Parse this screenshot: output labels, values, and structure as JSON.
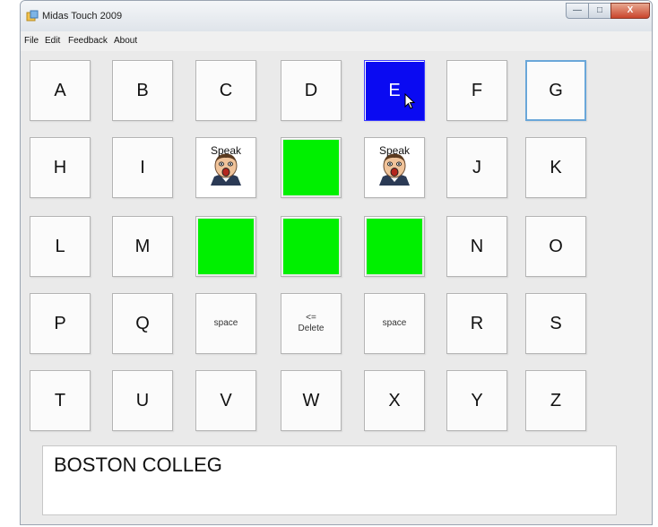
{
  "window": {
    "title": "Midas Touch 2009"
  },
  "titlebar_buttons": {
    "minimize": "—",
    "maximize": "□",
    "close": "X"
  },
  "menu": [
    "File",
    "Edit",
    "Feedback",
    "About"
  ],
  "grid": {
    "rows": [
      [
        {
          "type": "letter",
          "label": "A"
        },
        {
          "type": "letter",
          "label": "B"
        },
        {
          "type": "letter",
          "label": "C"
        },
        {
          "type": "letter",
          "label": "D"
        },
        {
          "type": "letter",
          "label": "E",
          "state": "selected"
        },
        {
          "type": "letter",
          "label": "F"
        },
        {
          "type": "letter",
          "label": "G",
          "state": "focused"
        }
      ],
      [
        {
          "type": "letter",
          "label": "H"
        },
        {
          "type": "letter",
          "label": "I"
        },
        {
          "type": "speak",
          "label": "Speak"
        },
        {
          "type": "green"
        },
        {
          "type": "speak",
          "label": "Speak"
        },
        {
          "type": "letter",
          "label": "J"
        },
        {
          "type": "letter",
          "label": "K"
        }
      ],
      [
        {
          "type": "letter",
          "label": "L"
        },
        {
          "type": "letter",
          "label": "M"
        },
        {
          "type": "green"
        },
        {
          "type": "green"
        },
        {
          "type": "green"
        },
        {
          "type": "letter",
          "label": "N"
        },
        {
          "type": "letter",
          "label": "O"
        }
      ],
      [
        {
          "type": "letter",
          "label": "P"
        },
        {
          "type": "letter",
          "label": "Q"
        },
        {
          "type": "small",
          "label": "space"
        },
        {
          "type": "small",
          "label": "<=\nDelete"
        },
        {
          "type": "small",
          "label": "space"
        },
        {
          "type": "letter",
          "label": "R"
        },
        {
          "type": "letter",
          "label": "S"
        }
      ],
      [
        {
          "type": "letter",
          "label": "T"
        },
        {
          "type": "letter",
          "label": "U"
        },
        {
          "type": "letter",
          "label": "V"
        },
        {
          "type": "letter",
          "label": "W"
        },
        {
          "type": "letter",
          "label": "X"
        },
        {
          "type": "letter",
          "label": "Y"
        },
        {
          "type": "letter",
          "label": "Z"
        }
      ]
    ]
  },
  "output_text": "BOSTON COLLEG",
  "colors": {
    "selected": "#0a0af2",
    "green": "#00f000",
    "focus": "#6aa7d9"
  }
}
